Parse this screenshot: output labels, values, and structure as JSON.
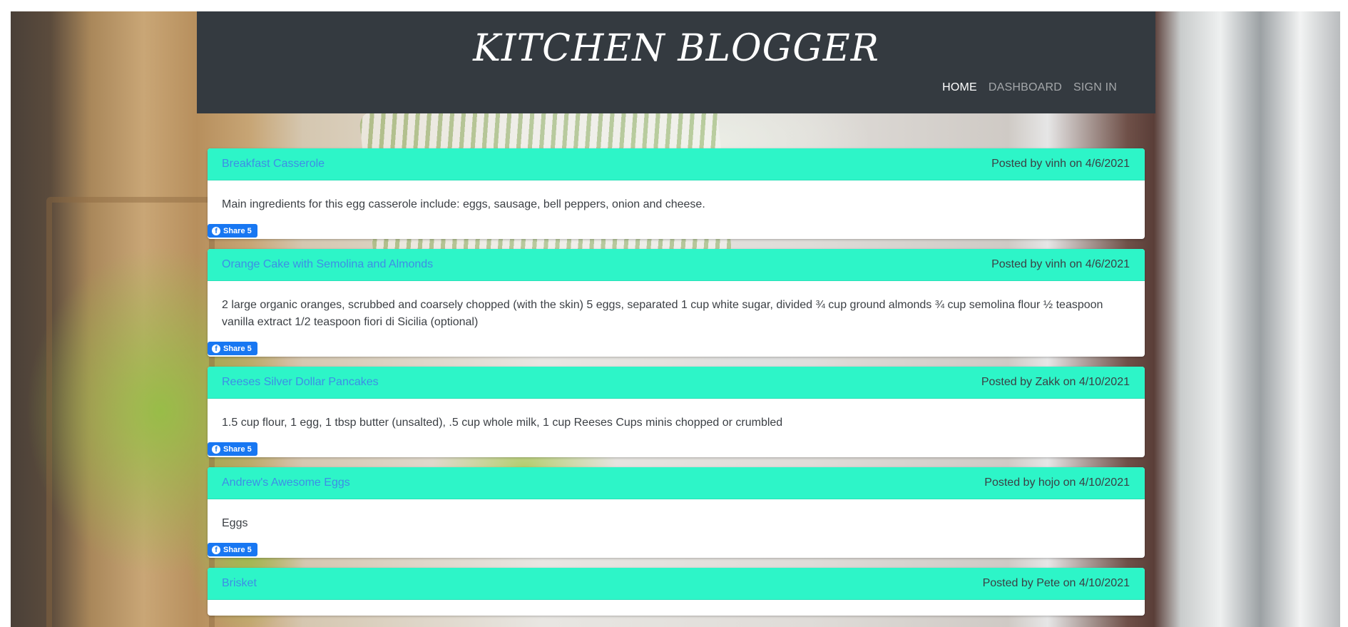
{
  "site": {
    "title": "KITCHEN BLOGGER"
  },
  "nav": [
    {
      "label": "HOME",
      "active": true
    },
    {
      "label": "DASHBOARD",
      "active": false
    },
    {
      "label": "SIGN IN",
      "active": false
    }
  ],
  "share_label": "Share 5",
  "posts": [
    {
      "title": "Breakfast Casserole",
      "meta": "Posted by vinh on 4/6/2021",
      "body": "Main ingredients for this egg casserole include: eggs, sausage, bell peppers, onion and cheese."
    },
    {
      "title": "Orange Cake with Semolina and Almonds",
      "meta": "Posted by vinh on 4/6/2021",
      "body": "2 large organic oranges, scrubbed and coarsely chopped (with the skin) 5 eggs, separated 1 cup white sugar, divided ¾ cup ground almonds ¾ cup semolina flour ½ teaspoon vanilla extract 1/2 teaspoon fiori di Sicilia (optional)"
    },
    {
      "title": "Reeses Silver Dollar Pancakes",
      "meta": "Posted by Zakk on 4/10/2021",
      "body": "1.5 cup flour, 1 egg, 1 tbsp butter (unsalted), .5 cup whole milk, 1 cup Reeses Cups minis chopped or crumbled"
    },
    {
      "title": "Andrew's Awesome Eggs",
      "meta": "Posted by hojo on 4/10/2021",
      "body": "Eggs"
    },
    {
      "title": "Brisket",
      "meta": "Posted by Pete on 4/10/2021",
      "body": ""
    }
  ],
  "colors": {
    "header_bg": "#343a40",
    "post_header_bg": "#2df5c8",
    "link": "#3d8ee6",
    "share_button": "#1877f2"
  }
}
